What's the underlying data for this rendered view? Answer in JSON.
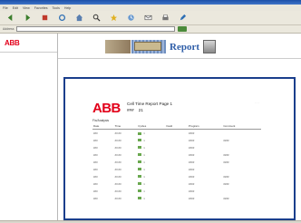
{
  "browser": {
    "menu_items": [
      "File",
      "Edit",
      "View",
      "Favorites",
      "Tools",
      "Help"
    ],
    "toolbar_icons": [
      "back-icon",
      "forward-icon",
      "stop-icon",
      "refresh-icon",
      "home-icon",
      "search-icon",
      "favorites-icon",
      "history-icon",
      "mail-icon",
      "print-icon",
      "edit-icon"
    ],
    "address_label": "Address",
    "address_value": "",
    "colors": {
      "titlebar": "#1c4fa8",
      "chrome": "#ebe8dd"
    }
  },
  "left_pane": {
    "logo": "ABB",
    "footer_lines": [
      "",
      "",
      ""
    ]
  },
  "banner": {
    "report_word": "Report"
  },
  "report": {
    "logo": "ABB",
    "title": "Cell Time Report",
    "title_suffix": "Page 1",
    "subtitle_a": "###",
    "subtitle_b": "21",
    "caption": "Fix/Analysis",
    "headers": [
      "Date",
      "Time",
      "Cycles",
      "Fault",
      "Program",
      "Comment"
    ],
    "rows": [
      [
        "###",
        "##:##",
        "1",
        "",
        "####",
        ""
      ],
      [
        "###",
        "##:##",
        "1",
        "",
        "####",
        "####"
      ],
      [
        "###",
        "##:##",
        "1",
        "",
        "####",
        ""
      ],
      [
        "###",
        "##:##",
        "1",
        "",
        "####",
        "####"
      ],
      [
        "###",
        "##:##",
        "1",
        "",
        "####",
        "####"
      ],
      [
        "###",
        "##:##",
        "1",
        "",
        "####",
        ""
      ],
      [
        "###",
        "##:##",
        "1",
        "",
        "####",
        "####"
      ],
      [
        "###",
        "##:##",
        "1",
        "",
        "####",
        "####"
      ],
      [
        "###",
        "##:##",
        "1",
        "",
        "####",
        ""
      ],
      [
        "###",
        "##:##",
        "1",
        "",
        "####",
        "####"
      ]
    ],
    "colors": {
      "brand_red": "#e2001a",
      "frame_blue": "#1a3e8c",
      "status_green": "#6aa84f"
    }
  }
}
